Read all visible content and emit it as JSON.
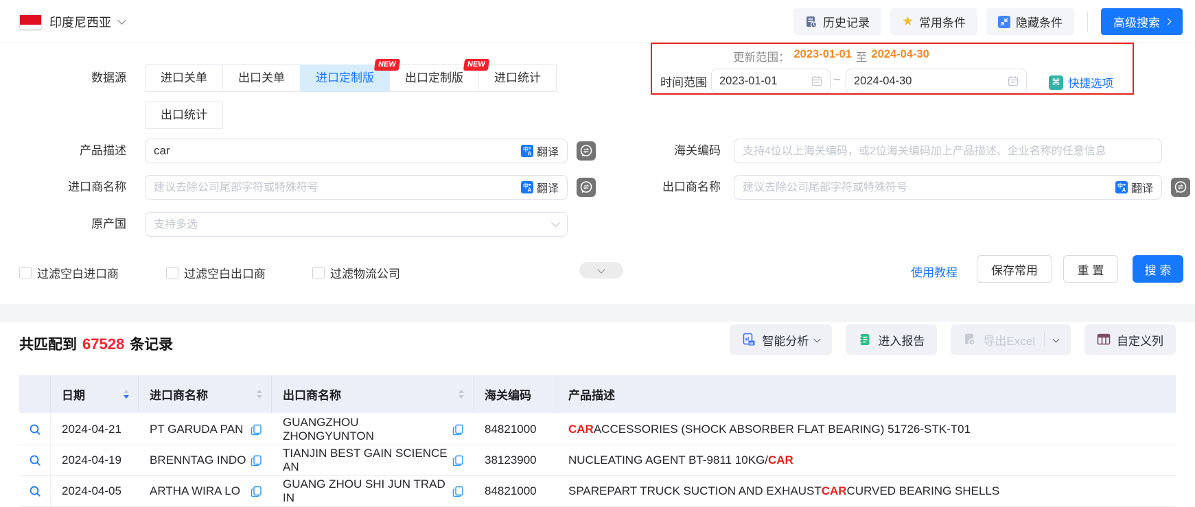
{
  "topbar": {
    "country": "印度尼西亚",
    "history_btn": "历史记录",
    "favorites_btn": "常用条件",
    "hide_btn": "隐藏条件",
    "advanced_btn": "高级搜索"
  },
  "icons": {
    "star_glyph": "★",
    "quick_options_glyph": "⌘"
  },
  "filters": {
    "datasource_label": "数据源",
    "new_badge": "NEW",
    "tabs": [
      {
        "label": "进口关单"
      },
      {
        "label": "出口关单"
      },
      {
        "label": "进口定制版",
        "active": true,
        "new": true
      },
      {
        "label": "出口定制版",
        "new": true
      },
      {
        "label": "进口统计"
      },
      {
        "label": "出口统计"
      }
    ],
    "update_range": {
      "prefix": "更新范围：",
      "start": "2023-01-01",
      "to": "至",
      "end": "2024-04-30"
    },
    "time_range_label": "时间范围",
    "date_start": "2023-01-01",
    "date_end": "2024-04-30",
    "date_separator": "–",
    "quick_options": "快捷选项",
    "translate_label": "翻译",
    "product_label": "产品描述",
    "product_value": "car",
    "hs_label": "海关编码",
    "hs_placeholder": "支持4位以上海关编码，或2位海关编码加上产品描述、企业名称的任意信息",
    "importer_label": "进口商名称",
    "importer_placeholder": "建议去除公司尾部字符或特殊符号",
    "exporter_label": "出口商名称",
    "exporter_placeholder": "建议去除公司尾部字符或特殊符号",
    "origin_label": "原产国",
    "origin_placeholder": "支持多选",
    "checkboxes": [
      "过滤空白进口商",
      "过滤空白出口商",
      "过滤物流公司"
    ],
    "tutorial_link": "使用教程",
    "save_btn": "保存常用",
    "reset_btn": "重 置",
    "search_btn": "搜 索"
  },
  "results": {
    "summary": {
      "prefix": "共匹配到",
      "count": "67528",
      "suffix": "条记录"
    },
    "toolbar": {
      "ai": "智能分析",
      "report": "进入报告",
      "export": "导出Excel",
      "custom_columns": "自定义列"
    }
  },
  "table": {
    "headers": {
      "date": "日期",
      "importer": "进口商名称",
      "exporter": "出口商名称",
      "hs_code": "海关编码",
      "product": "产品描述"
    },
    "rows": [
      {
        "date": "2024-04-21",
        "importer": "PT GARUDA PAN",
        "exporter": "GUANGZHOU ZHONGYUNTON",
        "hs_code": "84821000",
        "product": {
          "pre": "",
          "car": "CAR",
          "post": " ACCESSORIES (SHOCK ABSORBER FLAT BEARING) 51726-STK-T01"
        }
      },
      {
        "date": "2024-04-19",
        "importer": "BRENNTAG INDO",
        "exporter": "TIANJIN BEST GAIN SCIENCE AN",
        "hs_code": "38123900",
        "product": {
          "pre": "NUCLEATING AGENT BT-9811 10KG/",
          "car": "CAR",
          "post": ""
        }
      },
      {
        "date": "2024-04-05",
        "importer": "ARTHA WIRA LO",
        "exporter": "GUANG ZHOU SHI JUN TRAD IN",
        "hs_code": "84821000",
        "product": {
          "pre": "SPAREPART TRUCK SUCTION AND EXHAUST ",
          "car": "CAR",
          "post": " CURVED BEARING SHELLS"
        }
      }
    ]
  },
  "colors": {
    "primary_blue": "#1677ff",
    "active_tab_bg": "#d8edfc",
    "badge_red": "#f0222b",
    "highlight_red": "#e1251b",
    "count_red": "#f5222d",
    "date_orange": "#f28b24",
    "update_box_border": "#e0261c",
    "quick_icon_teal": "#33b3a6"
  }
}
